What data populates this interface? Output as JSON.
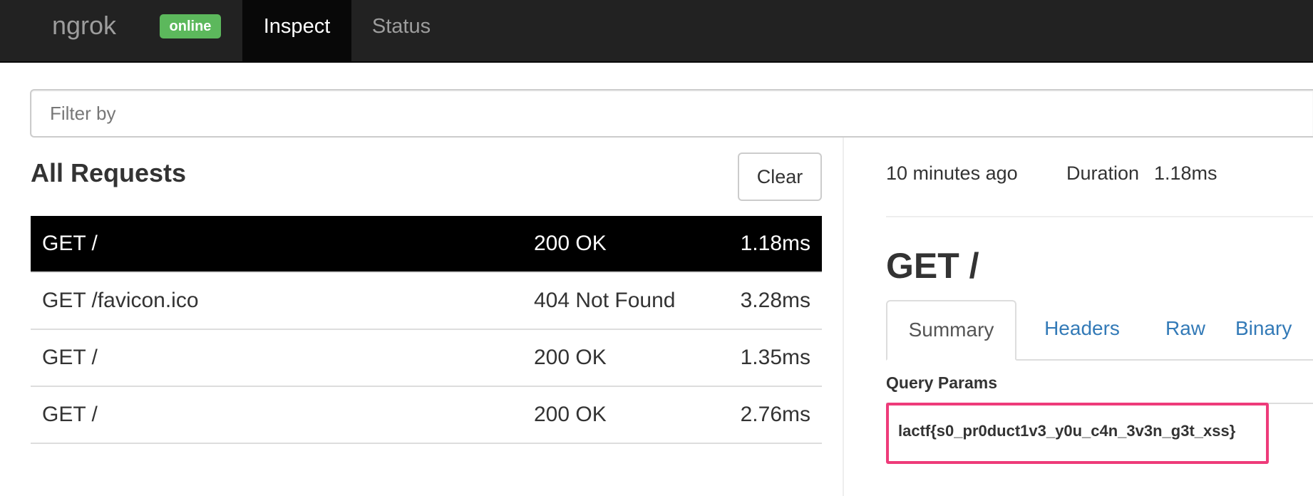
{
  "navbar": {
    "brand": "ngrok",
    "status_badge": "online",
    "tabs": [
      {
        "label": "Inspect",
        "active": true
      },
      {
        "label": "Status",
        "active": false
      }
    ]
  },
  "filter": {
    "placeholder": "Filter by",
    "value": ""
  },
  "requests": {
    "title": "All Requests",
    "clear_label": "Clear",
    "rows": [
      {
        "path": "GET /",
        "status": "200 OK",
        "duration": "1.18ms",
        "selected": true
      },
      {
        "path": "GET /favicon.ico",
        "status": "404 Not Found",
        "duration": "3.28ms",
        "selected": false
      },
      {
        "path": "GET /",
        "status": "200 OK",
        "duration": "1.35ms",
        "selected": false
      },
      {
        "path": "GET /",
        "status": "200 OK",
        "duration": "2.76ms",
        "selected": false
      }
    ]
  },
  "detail": {
    "time_ago": "10 minutes ago",
    "duration_label": "Duration",
    "duration_value": "1.18ms",
    "title": "GET /",
    "tabs": [
      {
        "label": "Summary",
        "active": true
      },
      {
        "label": "Headers",
        "active": false
      },
      {
        "label": "Raw",
        "active": false
      },
      {
        "label": "Binary",
        "active": false
      }
    ],
    "query_params_label": "Query Params",
    "query_params_value": "lactf{s0_pr0duct1v3_y0u_c4n_3v3n_g3t_xss}"
  },
  "colors": {
    "navbar_bg": "#222222",
    "badge_green": "#5cb85c",
    "link_blue": "#337ab7",
    "highlight_pink": "#ee3b7a",
    "selected_row_bg": "#000000"
  }
}
